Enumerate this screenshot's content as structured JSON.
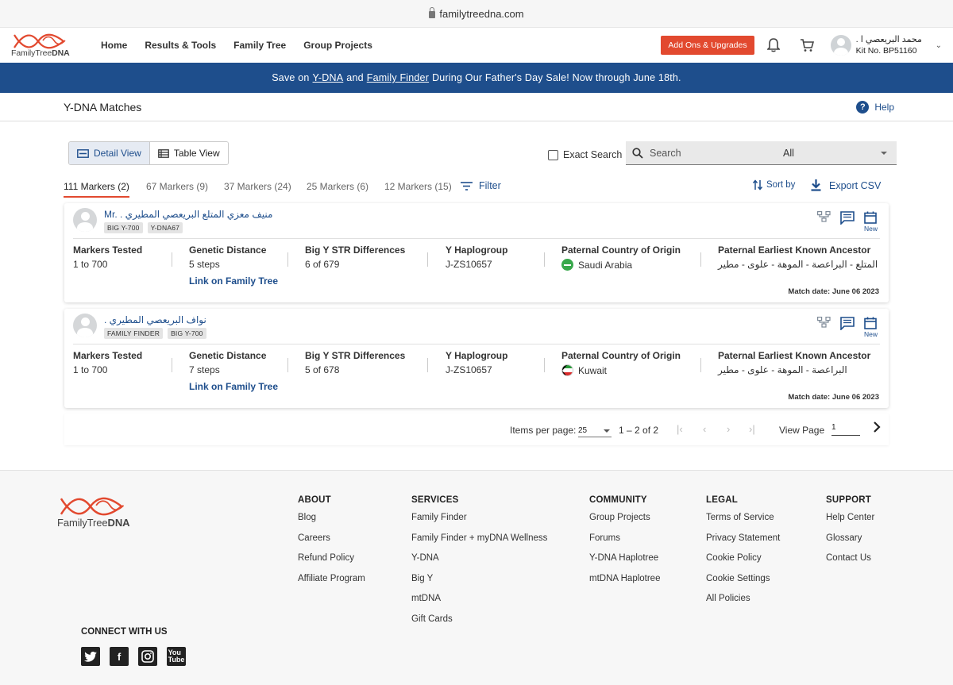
{
  "browser": {
    "url": "familytreedna.com"
  },
  "header": {
    "logo_prefix": "FamilyTree",
    "logo_suffix": "DNA",
    "nav": [
      "Home",
      "Results & Tools",
      "Family Tree",
      "Group Projects"
    ],
    "addons_label": "Add Ons & Upgrades",
    "user_name": "محمد البريعصي ا .",
    "kit_no": "Kit No. BP51160"
  },
  "banner": {
    "pre": "Save on",
    "link1": "Y-DNA",
    "mid": "and",
    "link2": "Family Finder",
    "post": "During Our Father's Day Sale! Now through June 18th."
  },
  "page": {
    "title": "Y-DNA Matches",
    "help_label": "Help"
  },
  "controls": {
    "detail_view": "Detail View",
    "table_view": "Table View",
    "exact_search": "Exact Search",
    "search_placeholder": "Search",
    "search_scope": "All"
  },
  "tabs": [
    "111 Markers (2)",
    "67 Markers (9)",
    "37 Markers (24)",
    "25 Markers (6)",
    "12 Markers (15)"
  ],
  "filter_label": "Filter",
  "sort_label": "Sort by",
  "export_label": "Export CSV",
  "columns": {
    "markers": "Markers Tested",
    "distance": "Genetic Distance",
    "bigy": "Big Y STR Differences",
    "haplo": "Y Haplogroup",
    "country": "Paternal Country of Origin",
    "ancestor": "Paternal Earliest Known Ancestor"
  },
  "matches": [
    {
      "name": "Mr. . منيف معزي المتلع البريعصي المطيري",
      "badges": [
        "BIG Y-700",
        "Y-DNA67"
      ],
      "markers": "1 to 700",
      "distance": "5 steps",
      "link_label": "Link on Family Tree",
      "bigy": "6 of 679",
      "haplo": "J-ZS10657",
      "country": "Saudi Arabia",
      "ancestor": "المتلع - البراعصة - الموهة - علوى - مطير",
      "match_date": "Match date: June 06 2023",
      "new_label": "New"
    },
    {
      "name": ". نواف البريعصي المطيري",
      "badges": [
        "FAMILY FINDER",
        "BIG Y-700"
      ],
      "markers": "1 to 700",
      "distance": "7 steps",
      "link_label": "Link on Family Tree",
      "bigy": "5 of 678",
      "haplo": "J-ZS10657",
      "country": "Kuwait",
      "ancestor": "البراعصة - الموهة - علوى - مطير",
      "match_date": "Match date: June 06 2023",
      "new_label": "New"
    }
  ],
  "pager": {
    "items_label": "Items per page:",
    "items_value": "25",
    "range": "1 – 2 of 2",
    "view_page_label": "View Page",
    "page_value": "1"
  },
  "footer": {
    "about": {
      "title": "ABOUT",
      "links": [
        "Blog",
        "Careers",
        "Refund Policy",
        "Affiliate Program"
      ]
    },
    "services": {
      "title": "SERVICES",
      "links": [
        "Family Finder",
        "Family Finder + myDNA Wellness",
        "Y-DNA",
        "Big Y",
        "mtDNA",
        "Gift Cards"
      ]
    },
    "community": {
      "title": "COMMUNITY",
      "links": [
        "Group Projects",
        "Forums",
        "Y-DNA Haplotree",
        "mtDNA Haplotree"
      ]
    },
    "legal": {
      "title": "LEGAL",
      "links": [
        "Terms of Service",
        "Privacy Statement",
        "Cookie Policy",
        "Cookie Settings",
        "All Policies"
      ]
    },
    "support": {
      "title": "SUPPORT",
      "links": [
        "Help Center",
        "Glossary",
        "Contact Us"
      ]
    },
    "connect": "CONNECT WITH US"
  },
  "colors": {
    "brand_blue": "#1e4e8c",
    "accent_orange": "#e2492f"
  }
}
